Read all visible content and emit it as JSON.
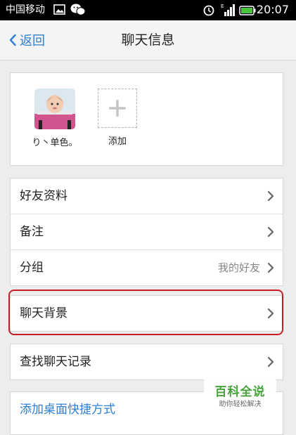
{
  "status_bar": {
    "carrier": "中国移动",
    "time": "20:07",
    "icons": [
      "image-icon",
      "wechat-icon",
      "alarm-icon",
      "signal-icon",
      "battery-icon"
    ]
  },
  "nav": {
    "back_label": "返回",
    "title": "聊天信息"
  },
  "members": [
    {
      "name": "り丶单色。",
      "type": "avatar"
    },
    {
      "name": "添加",
      "type": "add"
    }
  ],
  "groups": [
    [
      {
        "label": "好友资料",
        "value": ""
      },
      {
        "label": "备注",
        "value": ""
      },
      {
        "label": "分组",
        "value": "我的好友"
      }
    ],
    [
      {
        "label": "聊天背景",
        "value": "",
        "highlighted": true
      }
    ],
    [
      {
        "label": "查找聊天记录",
        "value": ""
      }
    ],
    [
      {
        "label": "添加桌面快捷方式",
        "value": ""
      }
    ]
  ],
  "watermark": {
    "main": "百科全说",
    "sub": "助你轻松解决"
  },
  "colors": {
    "accent": "#2c7fd3",
    "highlight_border": "#c81e23",
    "watermark_green": "#46a23a",
    "background": "#ededed"
  }
}
